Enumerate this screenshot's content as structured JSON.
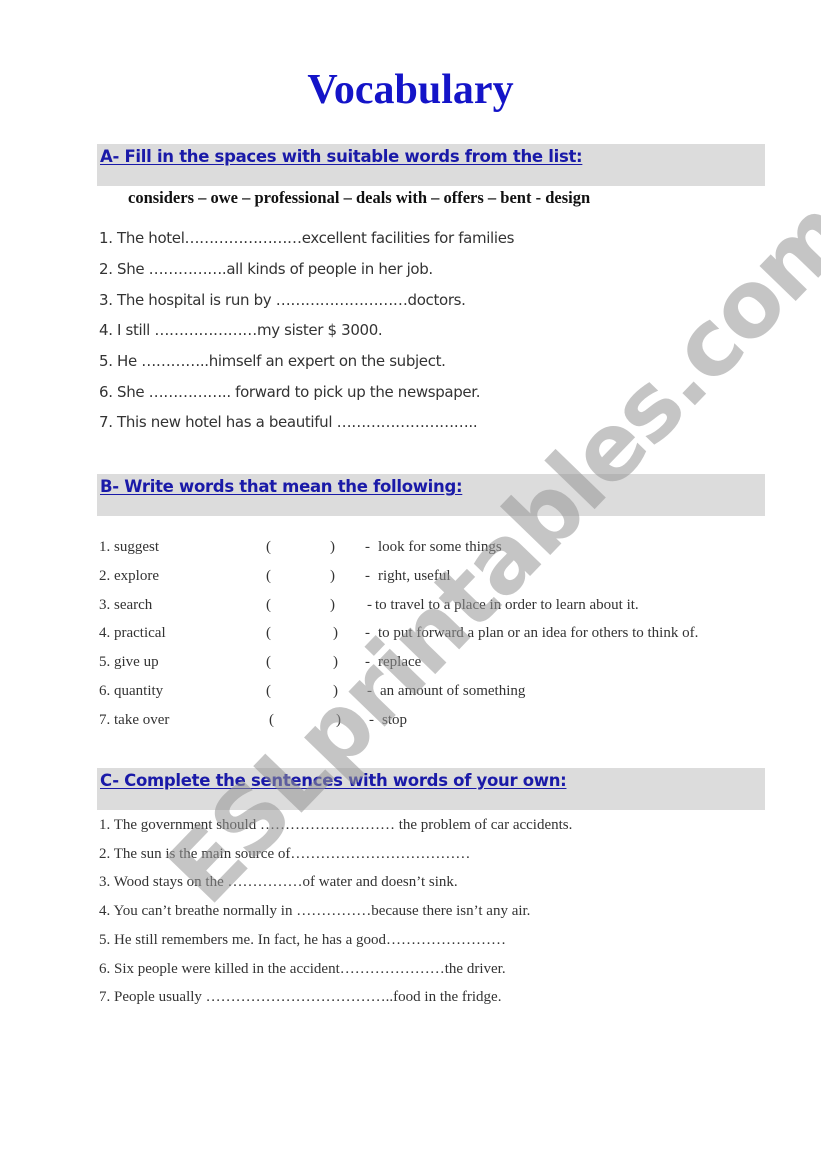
{
  "title": "Vocabulary",
  "watermark": "ESLprintables.com",
  "colors": {
    "title": "#1414c8",
    "section_title": "#1a1aa8",
    "section_bar": "#dcdcdc"
  },
  "section_a": {
    "heading": "A- Fill in the spaces with suitable words from the list:",
    "word_list": "considers – owe – professional – deals with – offers – bent - design",
    "items": [
      "1. The hotel……………………excellent facilities for families",
      "2. She …………….all kinds of people in her job.",
      "3. The hospital is run by ………………………doctors.",
      "4. I still …………………my sister $ 3000.",
      "5. He …………..himself an expert on the subject.",
      "6. She …………….. forward to pick up the newspaper.",
      "7. This new hotel has a beautiful ……………………….."
    ]
  },
  "section_b": {
    "heading": "B- Write words that mean the following:",
    "rows": [
      {
        "term": "1. suggest",
        "open": "(",
        "close": ")",
        "dash": "-",
        "definition": "look for some things"
      },
      {
        "term": "2. explore",
        "open": "(",
        "close": ")",
        "dash": "-",
        "definition": "right, useful"
      },
      {
        "term": "3. search",
        "open": "(",
        "close": ")",
        "dash": "-",
        "definition": "to travel to a place in order to learn about it."
      },
      {
        "term": "4. practical",
        "open": "(",
        "close": ")",
        "dash": "-",
        "definition": "to put forward a plan or an idea for others to think of."
      },
      {
        "term": "5. give up",
        "open": "(",
        "close": ")",
        "dash": "-",
        "definition": "replace"
      },
      {
        "term": "6. quantity",
        "open": "(",
        "close": ")",
        "dash": "-",
        "definition": "an amount of something"
      },
      {
        "term": "7. take over",
        "open": "(",
        "close": ")",
        "dash": "-",
        "definition": "stop"
      }
    ]
  },
  "section_c": {
    "heading": "C- Complete the sentences with words of your own:",
    "items": [
      "1. The government should ……………………… the problem of car accidents.",
      "2. The sun is the main source of………………………………",
      "3. Wood stays on the ……………of water and doesn’t sink.",
      "4. You can’t breathe normally in ……………because there isn’t any air.",
      "5. He still remembers me. In fact, he has a good……………………",
      "6. Six people were killed in the accident…………………the driver.",
      "7. People usually ………………………………..food in the fridge."
    ]
  }
}
